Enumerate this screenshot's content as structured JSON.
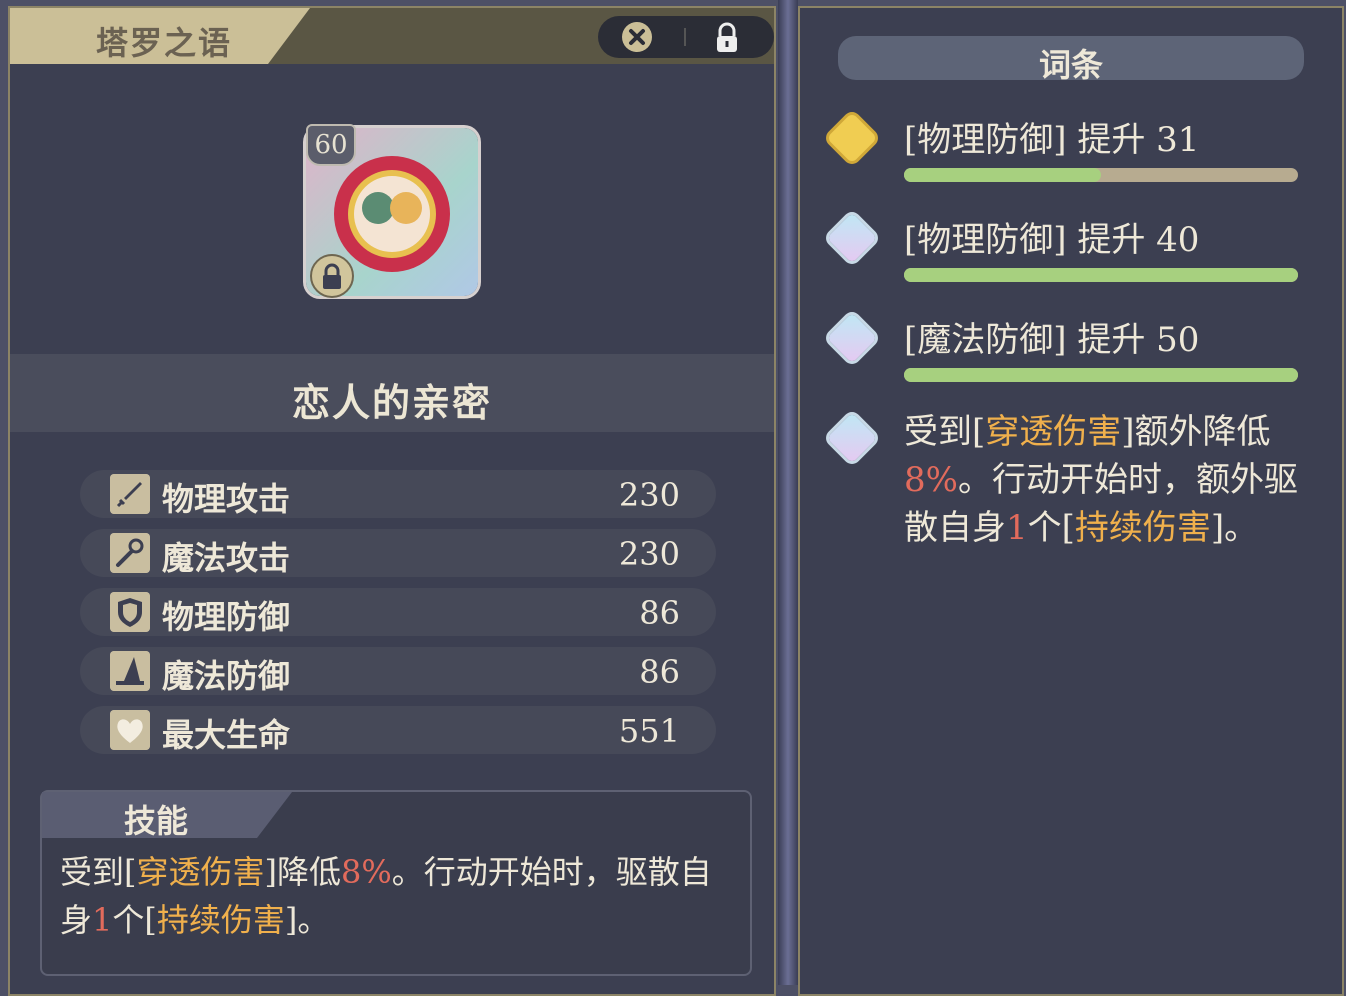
{
  "header": {
    "title": "塔罗之语"
  },
  "card": {
    "level": "60",
    "name": "恋人的亲密"
  },
  "stats": [
    {
      "label": "物理攻击",
      "value": "230",
      "icon": "sword-icon"
    },
    {
      "label": "魔法攻击",
      "value": "230",
      "icon": "staff-icon"
    },
    {
      "label": "物理防御",
      "value": "86",
      "icon": "shield-icon"
    },
    {
      "label": "魔法防御",
      "value": "86",
      "icon": "wizard-hat-icon"
    },
    {
      "label": "最大生命",
      "value": "551",
      "icon": "heart-icon"
    }
  ],
  "skill": {
    "title": "技能",
    "p1": "受到[",
    "h1": "穿透伤害",
    "p2": "]降低",
    "n1": "8%",
    "p3": "。行动开始时，驱散自身",
    "n2": "1",
    "p4": "个[",
    "h2": "持续伤害",
    "p5": "]。"
  },
  "affixes": {
    "title": "词条",
    "items": [
      {
        "text": "[物理防御] 提升 31",
        "gem": "gold",
        "fill": 0.5
      },
      {
        "text": "[物理防御] 提升 40",
        "gem": "blue",
        "fill": 1.0
      },
      {
        "text": "[魔法防御] 提升 50",
        "gem": "blue",
        "fill": 1.0
      }
    ],
    "desc": {
      "p1": "受到[",
      "h1": "穿透伤害",
      "p2": "]额外降低",
      "n1": "8%",
      "p3": "。行动开始时，额外驱散自身",
      "n2": "1",
      "p4": "个[",
      "h2": "持续伤害",
      "p5": "]。"
    }
  }
}
